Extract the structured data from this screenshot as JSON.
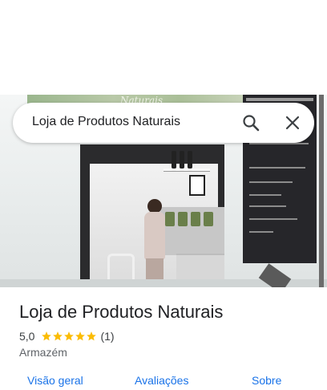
{
  "search": {
    "query": "Loja de Produtos Naturais",
    "search_icon": "search-icon",
    "close_icon": "close-icon"
  },
  "hero_photo": {
    "sign_text": "Naturais",
    "banner_lines": [
      "Aposentadoria por Invalidez",
      "Pensão por Morte",
      "Auxílio Doença",
      "Auxílio Acidente",
      "Revisão de Benefício",
      "BPC/LOAS"
    ]
  },
  "place": {
    "title": "Loja de Produtos Naturais",
    "rating_value": "5,0",
    "stars": 5,
    "review_count": "(1)",
    "category": "Armazém"
  },
  "colors": {
    "star": "#fbbc04",
    "link": "#1a73e8",
    "text_primary": "#202124",
    "text_secondary": "#5f6368"
  },
  "tabs": [
    {
      "label": "Visão geral"
    },
    {
      "label": "Avaliações"
    },
    {
      "label": "Sobre"
    }
  ]
}
